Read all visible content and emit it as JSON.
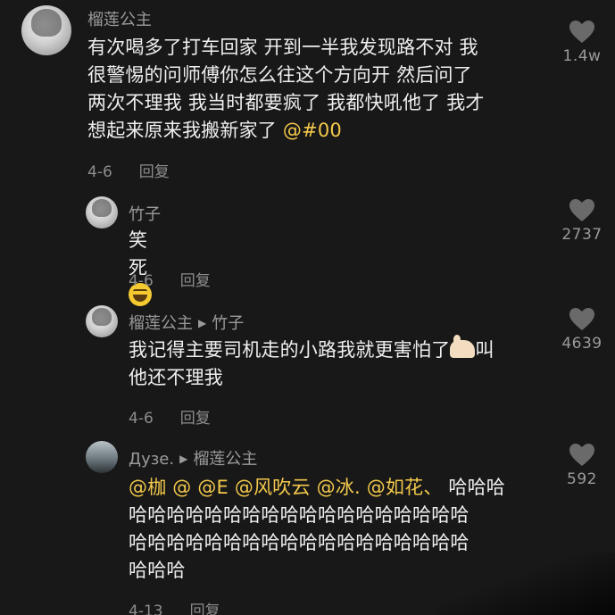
{
  "comments": [
    {
      "username": "榴莲公主",
      "lines": [
        "有次喝多了打车回家 开到一半我发现路不对 我",
        "很警惕的问师傅你怎么往这个方向开  然后问了",
        "两次不理我 我当时都要疯了 我都快吼他了 我才"
      ],
      "last_line_text": "想起来原来我搬新家了 ",
      "mention": "@#00",
      "date": "4-6",
      "reply_label": "回复",
      "likes": "1.4w"
    },
    {
      "username": "竹子",
      "text": "笑死",
      "emoji": "laughing-emoji",
      "date": "4-6",
      "reply_label": "回复",
      "likes": "2737"
    },
    {
      "username": "榴莲公主",
      "reply_to": "竹子",
      "line1": "我记得主要司机走的小路我就更害怕了",
      "line1_tail": "叫",
      "line2": "他还不理我",
      "emoji": "hand-emoji",
      "date": "4-6",
      "reply_label": "回复",
      "likes": "4639"
    },
    {
      "username": "Дузе.",
      "reply_to": "榴莲公主",
      "mentions": "@枷 @ @E @风吹云 @冰. @如花、",
      "line1_tail": "  哈哈哈",
      "line2": "哈哈哈哈哈哈哈哈哈哈哈哈哈哈哈哈哈哈",
      "line3": "哈哈哈哈哈哈哈哈哈哈哈哈哈哈哈哈哈哈",
      "line4": "哈哈哈",
      "date": "4-13",
      "reply_label": "回复",
      "likes": "592"
    }
  ],
  "colors": {
    "background": "#181818",
    "mention": "#f3c94b",
    "meta": "#8c8c8c"
  },
  "icons": {
    "like": "heart-icon",
    "reply_arrow": "triangle-right-icon"
  }
}
